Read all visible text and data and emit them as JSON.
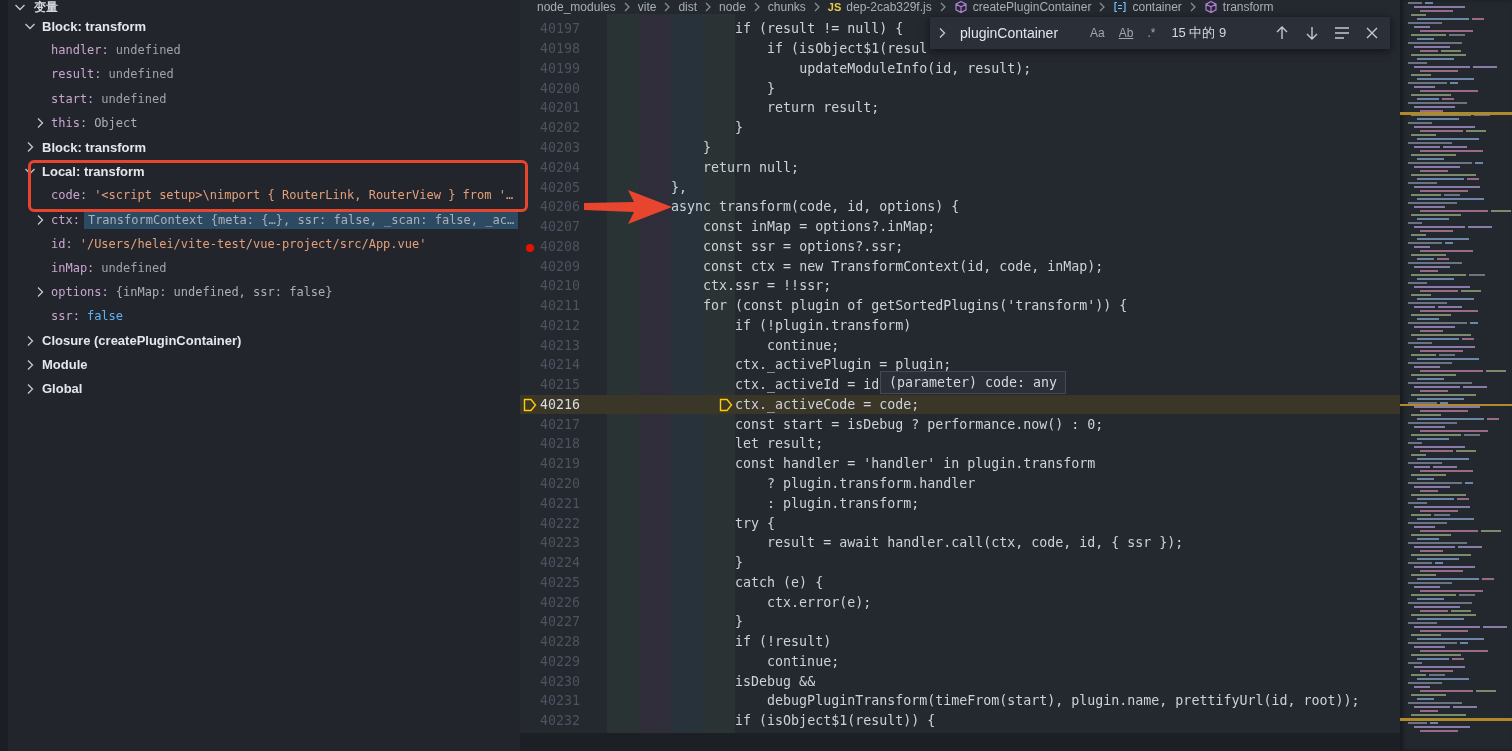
{
  "variables_panel": {
    "title": "变量",
    "expanded": true,
    "scopes": [
      {
        "label": "Block: transform",
        "expanded": true,
        "children": [
          {
            "name": "handler:",
            "value": "undefined",
            "kind": "undefined",
            "expandable": false
          },
          {
            "name": "result:",
            "value": "undefined",
            "kind": "undefined",
            "expandable": false
          },
          {
            "name": "start:",
            "value": "undefined",
            "kind": "undefined",
            "expandable": false
          },
          {
            "name": "this:",
            "value": "Object",
            "kind": "object",
            "expandable": true,
            "expanded": false
          }
        ]
      },
      {
        "label": "Block: transform",
        "expanded": false
      },
      {
        "label": "Local: transform",
        "expanded": true,
        "children": [
          {
            "name": "code:",
            "value": "'<script setup>\\nimport { RouterLink, RouterView } from '…",
            "kind": "string",
            "expandable": false
          },
          {
            "name": "ctx:",
            "value": "TransformContext {meta: {…}, ssr: false, _scan: false, _ac…",
            "kind": "object",
            "expandable": true,
            "expanded": false,
            "highlighted": true
          },
          {
            "name": "id:",
            "value": "'/Users/helei/vite-test/vue-project/src/App.vue'",
            "kind": "string",
            "expandable": false
          },
          {
            "name": "inMap:",
            "value": "undefined",
            "kind": "undefined",
            "expandable": false
          },
          {
            "name": "options:",
            "value": "{inMap: undefined, ssr: false}",
            "kind": "object",
            "expandable": true,
            "expanded": false
          },
          {
            "name": "ssr:",
            "value": "false",
            "kind": "boolean",
            "expandable": false
          }
        ]
      },
      {
        "label": "Closure (createPluginContainer)",
        "expanded": false
      },
      {
        "label": "Module",
        "expanded": false
      },
      {
        "label": "Global",
        "expanded": false
      }
    ]
  },
  "editor": {
    "breadcrumb": [
      {
        "label": "node_modules",
        "kind": "folder"
      },
      {
        "label": "vite",
        "kind": "folder"
      },
      {
        "label": "dist",
        "kind": "folder"
      },
      {
        "label": "node",
        "kind": "folder"
      },
      {
        "label": "chunks",
        "kind": "folder"
      },
      {
        "label": "dep-2cab329f.js",
        "kind": "file",
        "badge": "JS"
      },
      {
        "label": "createPluginContainer",
        "kind": "method"
      },
      {
        "label": "container",
        "kind": "variable"
      },
      {
        "label": "transform",
        "kind": "method"
      }
    ],
    "lines": [
      {
        "number": "40197",
        "text": "                if (result != null) {",
        "breakpoint": false,
        "current": false
      },
      {
        "number": "40198",
        "text": "                    if (isObject$1(resul",
        "breakpoint": false,
        "current": false
      },
      {
        "number": "40199",
        "text": "                        updateModuleInfo(id, result);",
        "breakpoint": false,
        "current": false
      },
      {
        "number": "40200",
        "text": "                    }",
        "breakpoint": false,
        "current": false
      },
      {
        "number": "40201",
        "text": "                    return result;",
        "breakpoint": false,
        "current": false
      },
      {
        "number": "40202",
        "text": "                }",
        "breakpoint": false,
        "current": false
      },
      {
        "number": "40203",
        "text": "            }",
        "breakpoint": false,
        "current": false
      },
      {
        "number": "40204",
        "text": "            return null;",
        "breakpoint": false,
        "current": false
      },
      {
        "number": "40205",
        "text": "        },",
        "breakpoint": false,
        "current": false
      },
      {
        "number": "40206",
        "text": "        async transform(code, id, options) {",
        "breakpoint": false,
        "current": false
      },
      {
        "number": "40207",
        "text": "            const inMap = options?.inMap;",
        "breakpoint": false,
        "current": false
      },
      {
        "number": "40208",
        "text": "            const ssr = options?.ssr;",
        "breakpoint": true,
        "current": false
      },
      {
        "number": "40209",
        "text": "            const ctx = new TransformContext(id, code, inMap);",
        "breakpoint": false,
        "current": false
      },
      {
        "number": "40210",
        "text": "            ctx.ssr = !!ssr;",
        "breakpoint": false,
        "current": false
      },
      {
        "number": "40211",
        "text": "            for (const plugin of getSortedPlugins('transform')) {",
        "breakpoint": false,
        "current": false
      },
      {
        "number": "40212",
        "text": "                if (!plugin.transform)",
        "breakpoint": false,
        "current": false
      },
      {
        "number": "40213",
        "text": "                    continue;",
        "breakpoint": false,
        "current": false
      },
      {
        "number": "40214",
        "text": "                ctx._activePlugin = plugin;",
        "breakpoint": false,
        "current": false
      },
      {
        "number": "40215",
        "text": "                ctx._activeId = id",
        "breakpoint": false,
        "current": false
      },
      {
        "number": "40216",
        "text": "                ctx._activeCode = code;",
        "breakpoint": false,
        "current": true
      },
      {
        "number": "40217",
        "text": "                const start = isDebug ? performance.now() : 0;",
        "breakpoint": false,
        "current": false
      },
      {
        "number": "40218",
        "text": "                let result;",
        "breakpoint": false,
        "current": false
      },
      {
        "number": "40219",
        "text": "                const handler = 'handler' in plugin.transform",
        "breakpoint": false,
        "current": false
      },
      {
        "number": "40220",
        "text": "                    ? plugin.transform.handler",
        "breakpoint": false,
        "current": false
      },
      {
        "number": "40221",
        "text": "                    : plugin.transform;",
        "breakpoint": false,
        "current": false
      },
      {
        "number": "40222",
        "text": "                try {",
        "breakpoint": false,
        "current": false
      },
      {
        "number": "40223",
        "text": "                    result = await handler.call(ctx, code, id, { ssr });",
        "breakpoint": false,
        "current": false
      },
      {
        "number": "40224",
        "text": "                }",
        "breakpoint": false,
        "current": false
      },
      {
        "number": "40225",
        "text": "                catch (e) {",
        "breakpoint": false,
        "current": false
      },
      {
        "number": "40226",
        "text": "                    ctx.error(e);",
        "breakpoint": false,
        "current": false
      },
      {
        "number": "40227",
        "text": "                }",
        "breakpoint": false,
        "current": false
      },
      {
        "number": "40228",
        "text": "                if (!result)",
        "breakpoint": false,
        "current": false
      },
      {
        "number": "40229",
        "text": "                    continue;",
        "breakpoint": false,
        "current": false
      },
      {
        "number": "40230",
        "text": "                isDebug &&",
        "breakpoint": false,
        "current": false
      },
      {
        "number": "40231",
        "text": "                    debugPluginTransform(timeFrom(start), plugin.name, prettifyUrl(id, root));",
        "breakpoint": false,
        "current": false
      },
      {
        "number": "40232",
        "text": "                if (isObject$1(result)) {",
        "breakpoint": false,
        "current": false
      }
    ],
    "find_widget": {
      "replace_expanded": false,
      "query": "pluginContainer",
      "options": [
        {
          "label": "Aa",
          "on": false
        },
        {
          "label": "Ab",
          "on": false
        },
        {
          "label": ".*",
          "on": false
        }
      ],
      "match_count": "15 中的 9"
    },
    "hover": {
      "text": "(parameter) code: any"
    }
  }
}
